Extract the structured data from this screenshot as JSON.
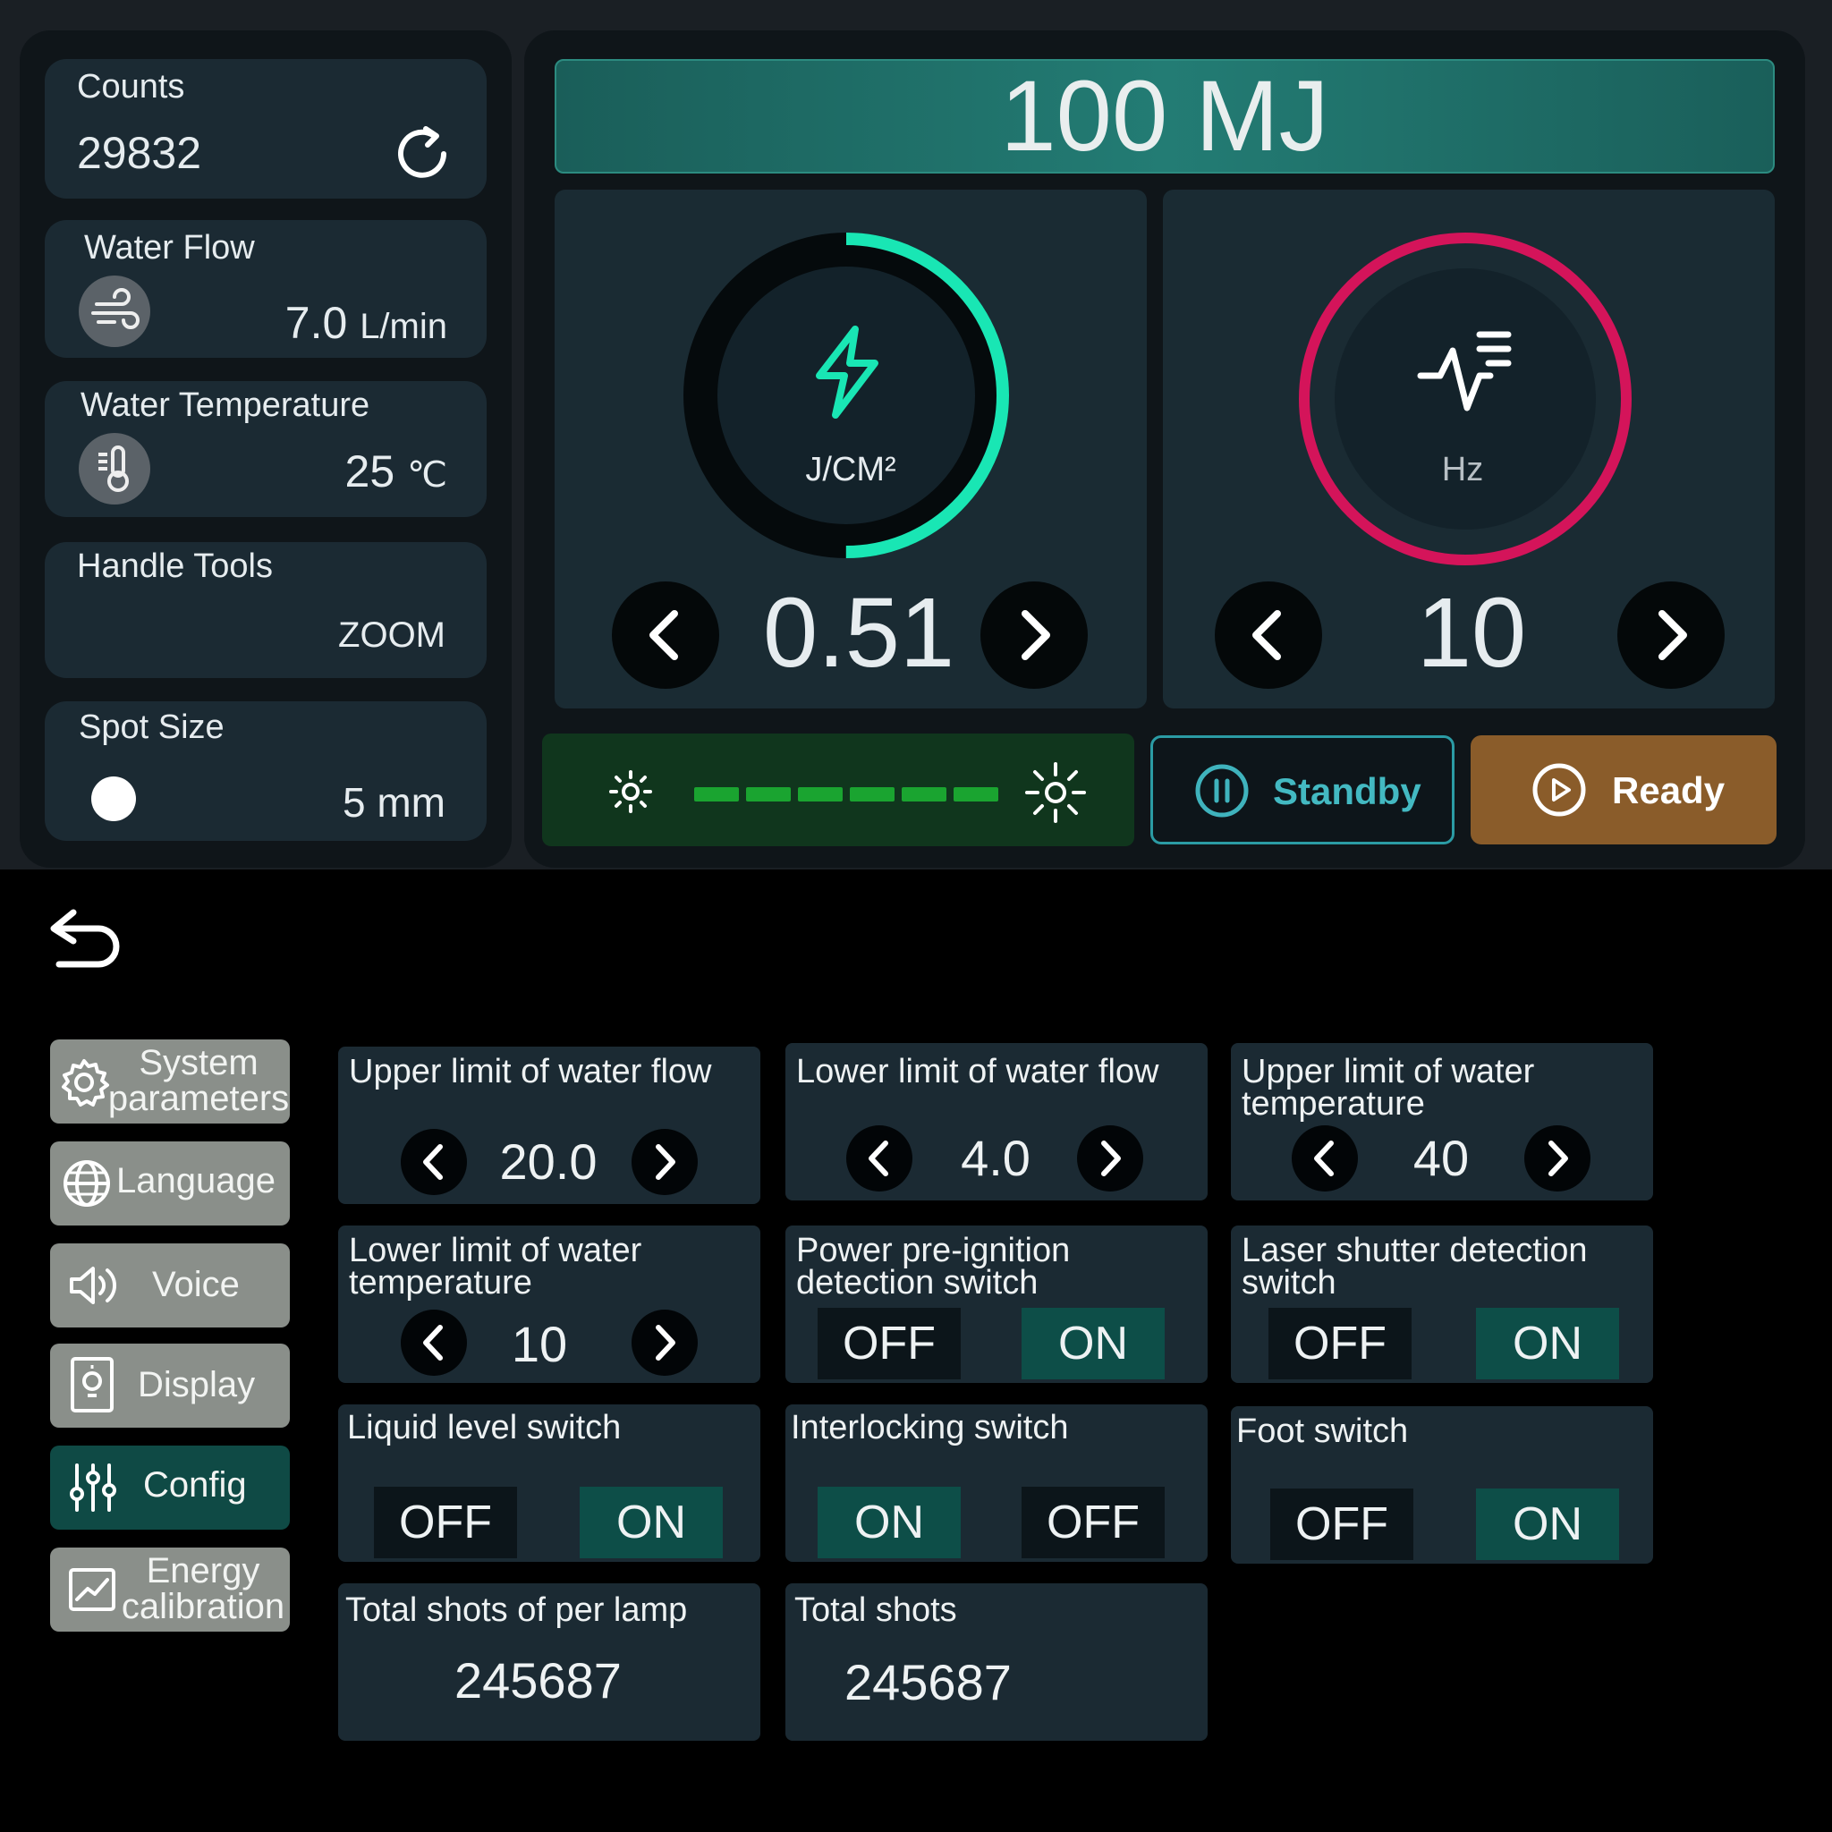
{
  "stats": {
    "counts": {
      "title": "Counts",
      "value": "29832"
    },
    "water_flow": {
      "title": "Water Flow",
      "value": "7.0",
      "unit": "L/min"
    },
    "water_temp": {
      "title": "Water Temperature",
      "value": "25",
      "unit": "℃"
    },
    "handle_tools": {
      "title": "Handle Tools",
      "value": "ZOOM"
    },
    "spot_size": {
      "title": "Spot Size",
      "value": "5 mm"
    }
  },
  "energy": {
    "label": "100 MJ"
  },
  "fluence": {
    "unit": "J/CM²",
    "value": "0.51",
    "ring_fraction": 0.5,
    "ring_color": "#19e6b4"
  },
  "frequency": {
    "unit": "Hz",
    "value": "10",
    "ring_fraction": 1.0,
    "ring_color": "#d4145a"
  },
  "brightness": {
    "level_segments": 6
  },
  "buttons": {
    "standby": "Standby",
    "ready": "Ready"
  },
  "nav": {
    "system": [
      "System",
      "parameters"
    ],
    "language": "Language",
    "voice": "Voice",
    "display": "Display",
    "config": "Config",
    "energy_cal": [
      "Energy",
      "calibration"
    ],
    "active": "config"
  },
  "settings": {
    "upper_water_flow": {
      "title": "Upper limit of water flow",
      "value": "20.0"
    },
    "lower_water_flow": {
      "title": "Lower limit of water flow",
      "value": "4.0"
    },
    "upper_water_temp": {
      "title": [
        "Upper limit of water",
        "temperature"
      ],
      "value": "40"
    },
    "lower_water_temp": {
      "title": [
        "Lower limit of water",
        "temperature"
      ],
      "value": "10"
    },
    "power_preignition": {
      "title": [
        "Power pre-ignition",
        "detection switch"
      ],
      "left": "OFF",
      "right": "ON",
      "state": "ON"
    },
    "laser_shutter": {
      "title": [
        "Laser shutter detection",
        "switch"
      ],
      "left": "OFF",
      "right": "ON",
      "state": "ON"
    },
    "liquid_level": {
      "title": "Liquid level switch",
      "left": "OFF",
      "right": "ON",
      "state": "ON"
    },
    "interlocking": {
      "title": "Interlocking switch",
      "left": "ON",
      "right": "OFF",
      "state": "ON"
    },
    "foot_switch": {
      "title": "Foot switch",
      "left": "OFF",
      "right": "ON",
      "state": "ON"
    },
    "total_per_lamp": {
      "title": "Total shots of per lamp",
      "value": "245687"
    },
    "total_shots": {
      "title": "Total shots",
      "value": "245687"
    }
  }
}
